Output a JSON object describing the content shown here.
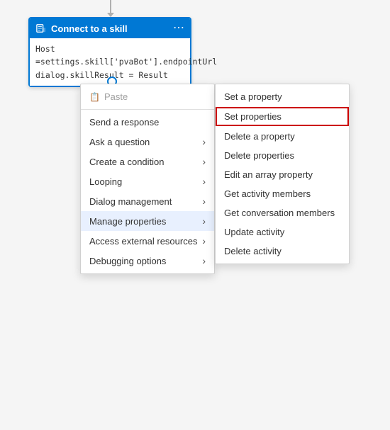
{
  "node": {
    "title": "Connect to a skill",
    "line1": "Host =settings.skill['pvaBot'].endpointUrl",
    "line2": "dialog.skillResult = Result",
    "menu_icon": "⋯"
  },
  "context_menu_main": {
    "items": [
      {
        "id": "paste",
        "label": "Paste",
        "disabled": true,
        "has_icon": true
      },
      {
        "id": "send-response",
        "label": "Send a response",
        "has_submenu": false
      },
      {
        "id": "ask-question",
        "label": "Ask a question",
        "has_submenu": true
      },
      {
        "id": "create-condition",
        "label": "Create a condition",
        "has_submenu": true
      },
      {
        "id": "looping",
        "label": "Looping",
        "has_submenu": true
      },
      {
        "id": "dialog-management",
        "label": "Dialog management",
        "has_submenu": true
      },
      {
        "id": "manage-properties",
        "label": "Manage properties",
        "has_submenu": true,
        "active": true
      },
      {
        "id": "access-external",
        "label": "Access external resources",
        "has_submenu": true
      },
      {
        "id": "debugging-options",
        "label": "Debugging options",
        "has_submenu": true
      }
    ]
  },
  "context_menu_sub": {
    "items": [
      {
        "id": "set-property",
        "label": "Set a property"
      },
      {
        "id": "set-properties",
        "label": "Set properties",
        "highlighted": true
      },
      {
        "id": "delete-property",
        "label": "Delete a property"
      },
      {
        "id": "delete-properties",
        "label": "Delete properties"
      },
      {
        "id": "edit-array-property",
        "label": "Edit an array property"
      },
      {
        "id": "get-activity-members",
        "label": "Get activity members"
      },
      {
        "id": "get-conversation-members",
        "label": "Get conversation members"
      },
      {
        "id": "update-activity",
        "label": "Update activity"
      },
      {
        "id": "delete-activity",
        "label": "Delete activity"
      }
    ]
  }
}
